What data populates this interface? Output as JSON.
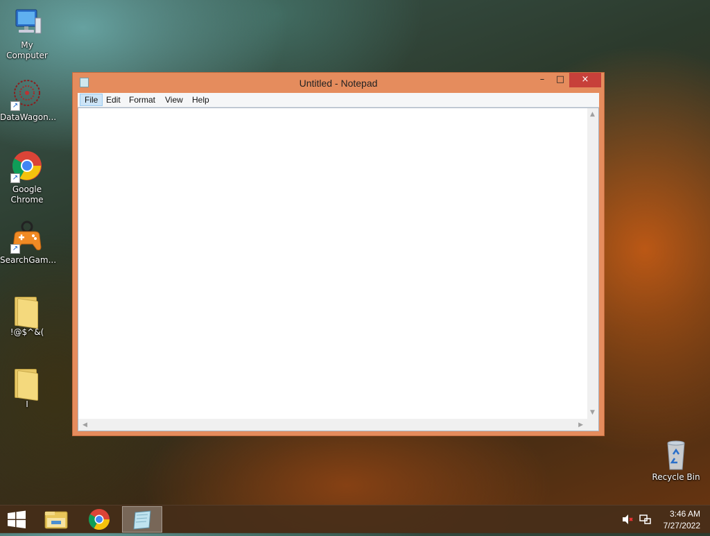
{
  "desktop": {
    "icons": [
      {
        "label": "My Computer"
      },
      {
        "label": "DataWagon..."
      },
      {
        "label": "Google Chrome"
      },
      {
        "label": "SearchGam..."
      },
      {
        "label": "!@$^&("
      },
      {
        "label": "I"
      }
    ],
    "recycle_bin": {
      "label": "Recycle Bin"
    }
  },
  "notepad": {
    "title": "Untitled - Notepad",
    "controls": {
      "minimize": "–",
      "maximize": "□",
      "close": "×"
    },
    "menu": [
      "File",
      "Edit",
      "Format",
      "View",
      "Help"
    ],
    "active_menu": "File",
    "content": ""
  },
  "taskbar": {
    "items": [
      "start",
      "file-explorer",
      "google-chrome",
      "notepad"
    ],
    "active": "notepad",
    "clock": {
      "time": "3:46 AM",
      "date": "7/27/2022"
    }
  },
  "colors": {
    "window_frame": "#e58c5d",
    "close_button": "#c7403a",
    "menu_highlight": "#cce4f7"
  }
}
